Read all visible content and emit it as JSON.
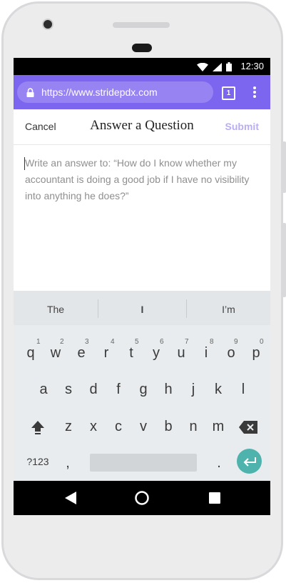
{
  "status_bar": {
    "time": "12:30"
  },
  "browser": {
    "url": "https://www.stridepdx.com",
    "tab_count": "1"
  },
  "header": {
    "cancel_label": "Cancel",
    "title": "Answer a Question",
    "submit_label": "Submit"
  },
  "answer": {
    "placeholder": "Write an answer to: “How do I know whether my accountant is doing a good job if I have no visibility into anything he does?”"
  },
  "keyboard": {
    "suggestions": [
      "The",
      "I",
      "I’m"
    ],
    "row1": [
      "q",
      "w",
      "e",
      "r",
      "t",
      "y",
      "u",
      "i",
      "o",
      "p"
    ],
    "row1_numbers": [
      "1",
      "2",
      "3",
      "4",
      "5",
      "6",
      "7",
      "8",
      "9",
      "0"
    ],
    "row2": [
      "a",
      "s",
      "d",
      "f",
      "g",
      "h",
      "j",
      "k",
      "l"
    ],
    "row3": [
      "z",
      "x",
      "c",
      "v",
      "b",
      "n",
      "m"
    ],
    "symbols_label": "?123",
    "comma": ",",
    "period": "."
  },
  "colors": {
    "accent": "#7c65ef",
    "submit_disabled": "#b9aef5",
    "enter_key": "#4fb3ad"
  },
  "icons": [
    "wifi-icon",
    "signal-icon",
    "battery-icon",
    "lock-icon",
    "tabs-icon",
    "more-vert-icon",
    "shift-icon",
    "backspace-icon",
    "enter-icon",
    "back-icon",
    "home-icon",
    "recents-icon"
  ]
}
